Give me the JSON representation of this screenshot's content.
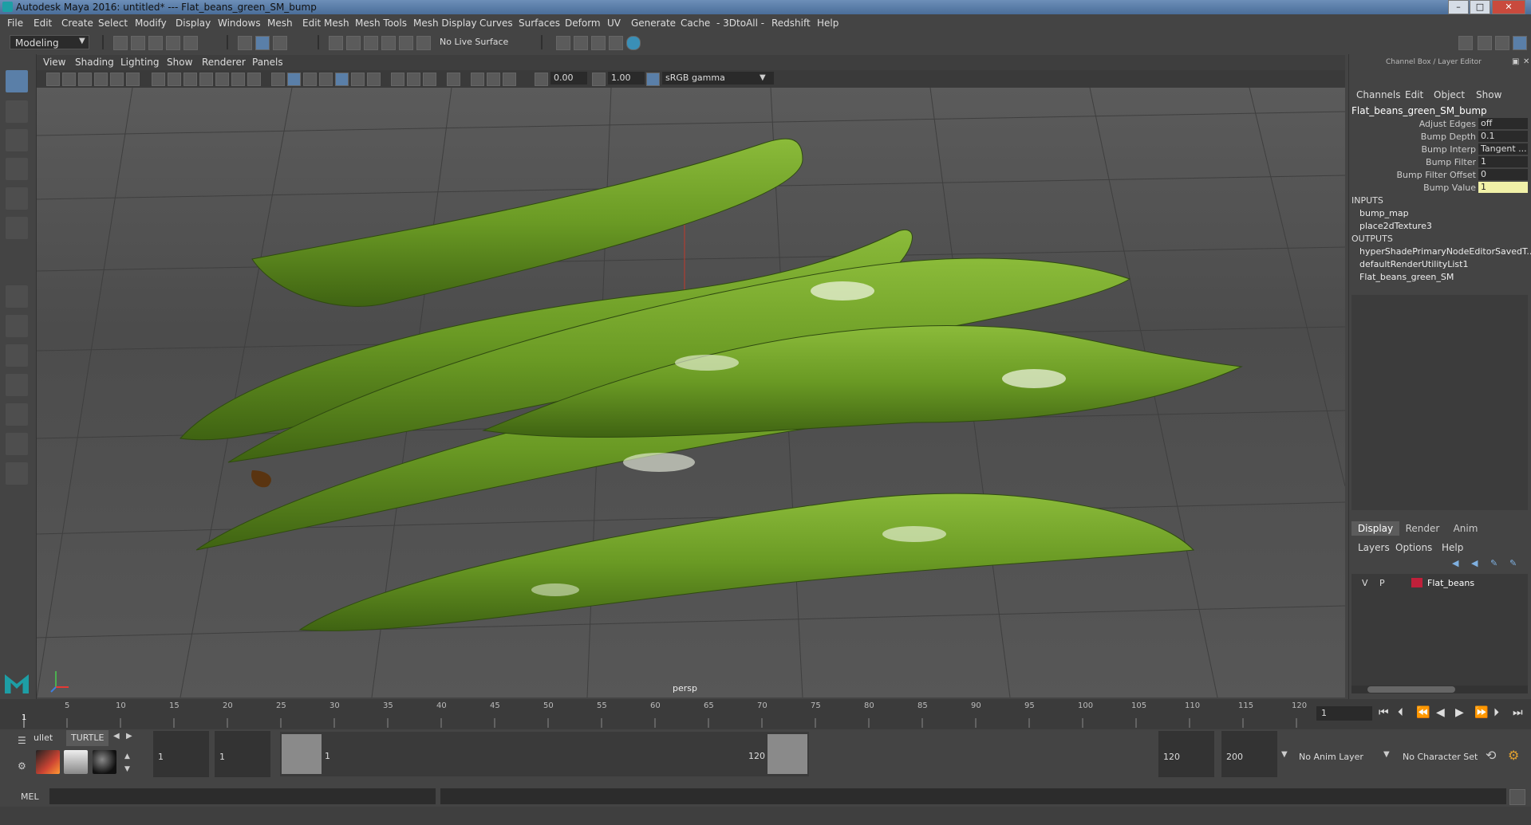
{
  "window": {
    "title": "Autodesk Maya 2016: untitled*   ---   Flat_beans_green_SM_bump",
    "minimize": "–",
    "maximize": "□",
    "close": "✕"
  },
  "menubar": [
    "File",
    "Edit",
    "Create",
    "Select",
    "Modify",
    "Display",
    "Windows",
    "Mesh",
    "Edit Mesh",
    "Mesh Tools",
    "Mesh Display",
    "Curves",
    "Surfaces",
    "Deform",
    "UV",
    "Generate",
    "Cache",
    "- 3DtoAll -",
    "Redshift",
    "Help"
  ],
  "toolbar": {
    "mode": "Modeling",
    "live_surface": "No Live Surface"
  },
  "panel": {
    "menus": [
      "View",
      "Shading",
      "Lighting",
      "Show",
      "Renderer",
      "Panels"
    ],
    "exposure": "0.00",
    "gamma": "1.00",
    "color_space": "sRGB gamma",
    "camera_label": "persp"
  },
  "channel_box": {
    "title": "Channel Box / Layer Editor",
    "menus": [
      "Channels",
      "Edit",
      "Object",
      "Show"
    ],
    "node_name": "Flat_beans_green_SM_bump",
    "attributes": [
      {
        "label": "Adjust Edges",
        "value": "off"
      },
      {
        "label": "Bump Depth",
        "value": "0.1"
      },
      {
        "label": "Bump Interp",
        "value": "Tangent ..."
      },
      {
        "label": "Bump Filter",
        "value": "1"
      },
      {
        "label": "Bump Filter Offset",
        "value": "0"
      },
      {
        "label": "Bump Value",
        "value": "1"
      }
    ],
    "inputs_header": "INPUTS",
    "inputs": [
      "bump_map",
      "place2dTexture3"
    ],
    "outputs_header": "OUTPUTS",
    "outputs": [
      "hyperShadePrimaryNodeEditorSavedT...",
      "defaultRenderUtilityList1",
      "Flat_beans_green_SM"
    ]
  },
  "layer_editor": {
    "tabs": [
      "Display",
      "Render",
      "Anim"
    ],
    "active_tab": "Display",
    "menus": [
      "Layers",
      "Options",
      "Help"
    ],
    "layers": [
      {
        "v": "V",
        "p": "P",
        "name": "Flat_beans",
        "color": "#c0203a"
      }
    ]
  },
  "timeline": {
    "ticks": [
      "1",
      "5",
      "10",
      "15",
      "20",
      "25",
      "30",
      "35",
      "40",
      "45",
      "50",
      "55",
      "60",
      "65",
      "70",
      "75",
      "80",
      "85",
      "90",
      "95",
      "100",
      "105",
      "110",
      "115",
      "120"
    ],
    "current_frame": "1"
  },
  "range": {
    "start": "1",
    "range_start": "1",
    "thumb_start_label": "1",
    "thumb_end_label": "120",
    "range_end": "120",
    "end": "200",
    "anim_layer": "No Anim Layer",
    "character_set": "No Character Set"
  },
  "shelf": {
    "tabs": [
      "ullet",
      "TURTLE"
    ],
    "active_tab": "TURTLE"
  },
  "mel": {
    "label": "MEL"
  },
  "colors": {
    "accent": "#5a7fa8",
    "bean": "#6a9a2a",
    "highlight_field": "#f1f1a8"
  }
}
